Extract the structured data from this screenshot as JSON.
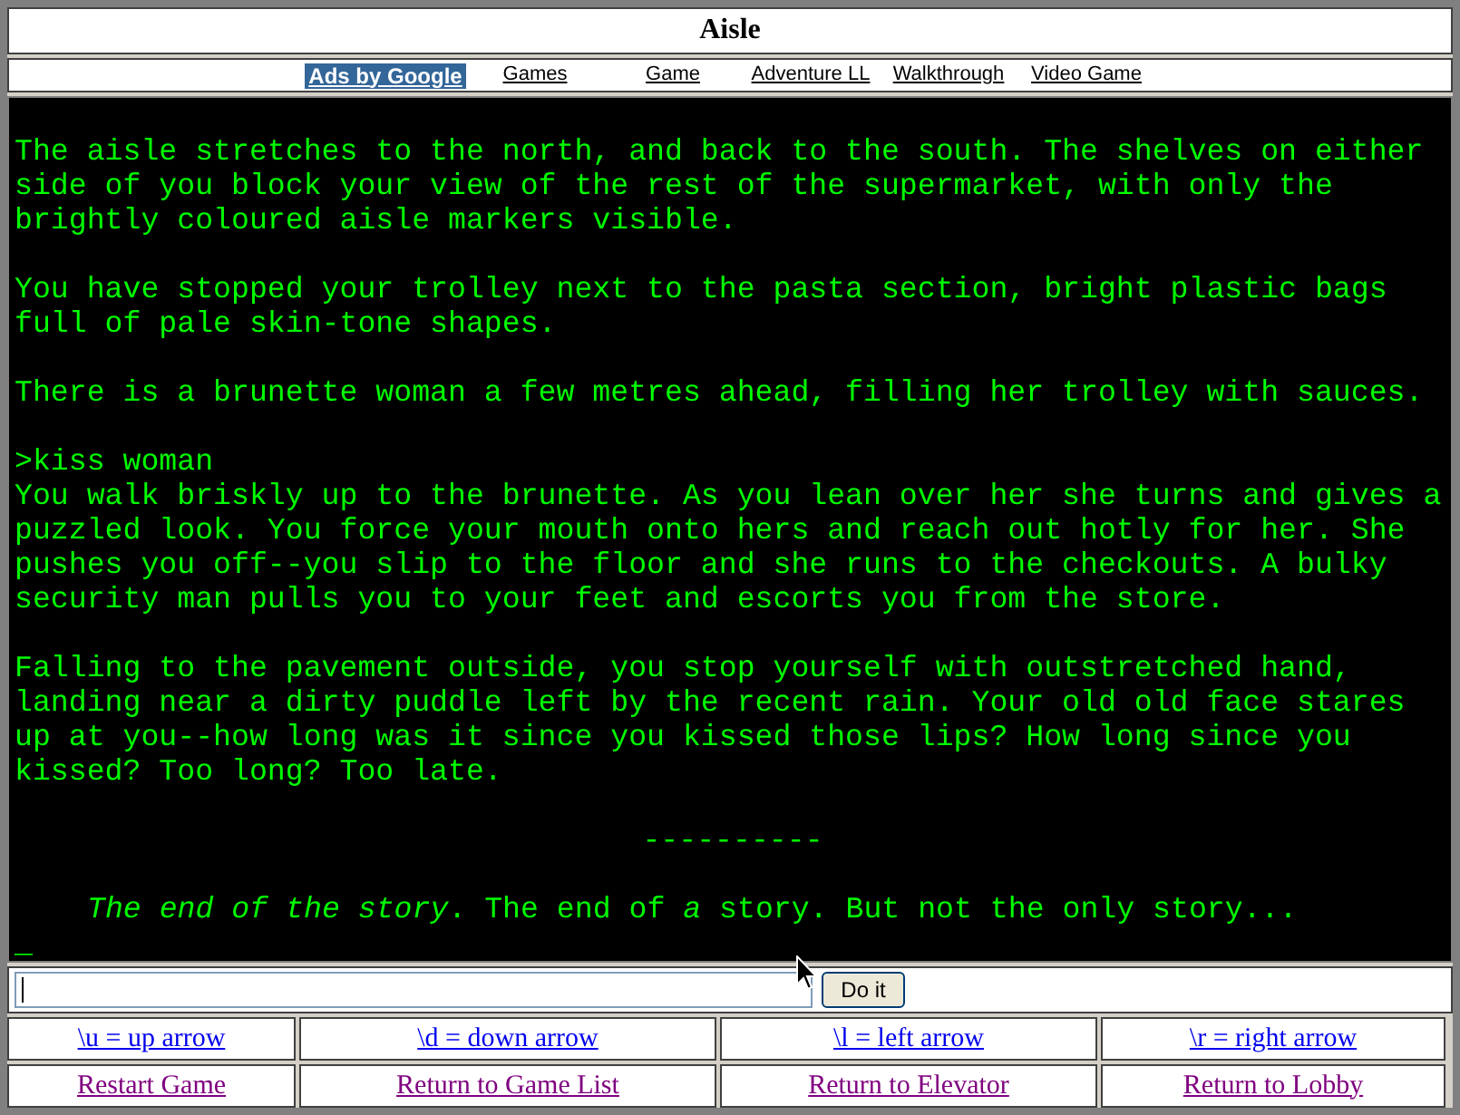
{
  "window": {
    "title": "Aisle"
  },
  "ad_bar": {
    "ads_label": "Ads by Google",
    "links": [
      "Games",
      "Game",
      "Adventure LL",
      "Walkthrough",
      "Video Game"
    ]
  },
  "transcript": {
    "blocks": [
      {
        "kind": "text",
        "lines": [
          "The aisle stretches to the north, and back to the south. The shelves on either",
          "side of you block your view of the rest of the supermarket, with only the",
          "brightly coloured aisle markers visible."
        ]
      },
      {
        "kind": "text",
        "lines": [
          "You have stopped your trolley next to the pasta section, bright plastic bags",
          "full of pale skin-tone shapes."
        ]
      },
      {
        "kind": "text",
        "lines": [
          "There is a brunette woman a few metres ahead, filling her trolley with sauces."
        ]
      },
      {
        "kind": "command",
        "lines": [
          ">kiss woman"
        ]
      },
      {
        "kind": "text",
        "lines": [
          "You walk briskly up to the brunette. As you lean over her she turns and gives a",
          "puzzled look. You force your mouth onto hers and reach out hotly for her. She",
          "pushes you off--you slip to the floor and she runs to the checkouts. A bulky",
          "security man pulls you to your feet and escorts you from the store."
        ]
      },
      {
        "kind": "text",
        "lines": [
          "Falling to the pavement outside, you stop yourself with outstretched hand,",
          "landing near a dirty puddle left by the recent rain. Your old old face stares",
          "up at you--how long was it since you kissed those lips? How long since you",
          "kissed? Too long? Too late."
        ]
      },
      {
        "kind": "separator",
        "lines": [
          "----------"
        ]
      },
      {
        "kind": "ending",
        "lines": [
          "*The end of the story*. The end of *a* story. But not the only story..."
        ]
      }
    ],
    "cursor": "_"
  },
  "command_form": {
    "button": "Do it"
  },
  "footer_links": [
    {
      "links": [
        {
          "label": "\\u = up arrow",
          "visited": false
        },
        {
          "label": "\\d = down arrow",
          "visited": false
        },
        {
          "label": "\\l = left arrow",
          "visited": false
        },
        {
          "label": "\\r = right arrow",
          "visited": false
        }
      ]
    },
    {
      "links": [
        {
          "label": "Restart Game",
          "visited": true
        },
        {
          "label": "Return to Game List",
          "visited": true
        },
        {
          "label": "Return to Elevator",
          "visited": true
        },
        {
          "label": "Return to Lobby",
          "visited": true
        }
      ]
    }
  ]
}
